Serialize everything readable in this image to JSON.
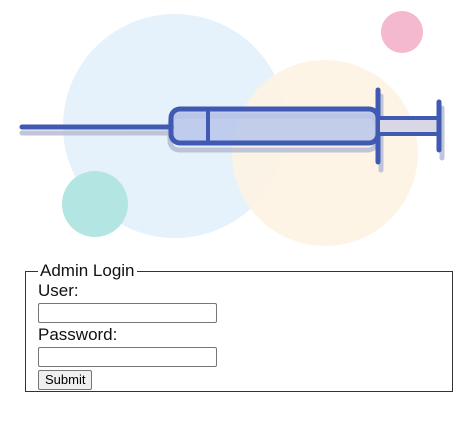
{
  "illustration": {
    "icon": "syringe-icon",
    "colors": {
      "syringe_stroke": "#4059b2",
      "syringe_fill": "#b7c6ea",
      "circle_blue": "#e6f2fb",
      "circle_peach": "#fdf3e4",
      "circle_teal": "#b3e6e2",
      "circle_pink": "#f4b8cf",
      "shadow": "#b9bfd6"
    }
  },
  "login": {
    "legend": "Admin Login",
    "user_label": "User:",
    "user_value": "",
    "password_label": "Password:",
    "password_value": "",
    "submit_label": "Submit"
  }
}
